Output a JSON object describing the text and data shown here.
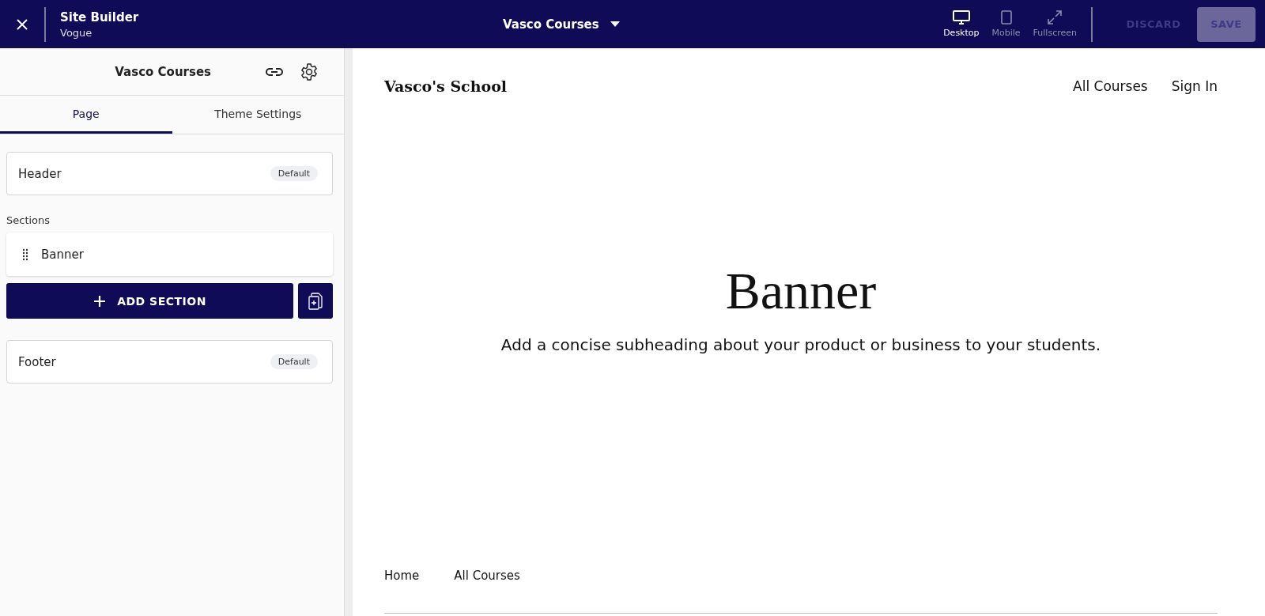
{
  "topbar": {
    "title": "Site Builder",
    "subtitle": "Vogue",
    "page_selector": "Vasco Courses",
    "view_modes": [
      {
        "kind": "desktop",
        "label": "Desktop",
        "selected": true
      },
      {
        "kind": "mobile",
        "label": "Mobile",
        "selected": false
      },
      {
        "kind": "fullscreen",
        "label": "Fullscreen",
        "selected": false
      }
    ],
    "buttons": [
      {
        "kind": "text",
        "label": "DISCARD",
        "disabled": true
      },
      {
        "kind": "filled",
        "label": "SAVE",
        "disabled": true
      }
    ]
  },
  "sidebar": {
    "title": "Vasco Courses",
    "tabs": [
      {
        "label": "Page",
        "selected": true
      },
      {
        "label": "Theme Settings",
        "selected": false
      }
    ],
    "header": {
      "label": "Header",
      "badge": "Default"
    },
    "sections_label": "Sections",
    "sections": [
      {
        "label": "Banner"
      }
    ],
    "add_section": "ADD SECTION",
    "footer": {
      "label": "Footer",
      "badge": "Default"
    }
  },
  "preview": {
    "brand": "Vasco's School",
    "nav": [
      "All Courses",
      "Sign In"
    ],
    "heading": "Banner",
    "subheading": "Add a concise subheading about your product or business to your students.",
    "footer_links": [
      "Home",
      "All Courses"
    ]
  }
}
